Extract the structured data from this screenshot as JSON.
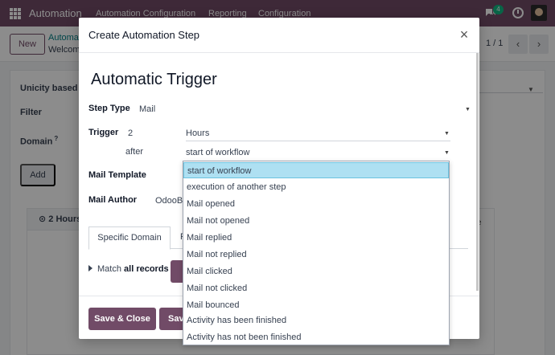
{
  "navbar": {
    "app_name": "Automation",
    "menus": [
      "Automation Configuration",
      "Reporting",
      "Configuration"
    ],
    "chat_badge": "4"
  },
  "control_panel": {
    "new_label": "New",
    "breadcrumb_parent": "Automa",
    "breadcrumb_current": "Welcom",
    "pager": "1 / 1"
  },
  "bg_form": {
    "unicity_label": "Unicity based o",
    "filter_label": "Filter",
    "domain_label": "Domain",
    "domain_help": "?",
    "add_label": "Add",
    "card_tab": "2 Hours",
    "card_e": "e"
  },
  "modal": {
    "title": "Create Automation Step",
    "heading": "Automatic Trigger",
    "step_type_label": "Step Type",
    "step_type_value": "Mail",
    "trigger_label": "Trigger",
    "trigger_interval": "2",
    "trigger_unit": "Hours",
    "trigger_after": "after",
    "trigger_type": "start of workflow",
    "mail_template_label": "Mail Template",
    "mail_author_label": "Mail Author",
    "mail_author_value": "OdooB",
    "tab_specific_domain": "Specific Domain",
    "tab_second": "F",
    "match_prefix": "Match",
    "match_bold": "all records",
    "save_close_label": "Save & Close",
    "save_label": "Save"
  },
  "dropdown": {
    "options": [
      "start of workflow",
      "execution of another step",
      "Mail opened",
      "Mail not opened",
      "Mail replied",
      "Mail not replied",
      "Mail clicked",
      "Mail not clicked",
      "Mail bounced",
      "Activity has been finished",
      "Activity has not been finished"
    ],
    "selected": "start of workflow"
  },
  "colors": {
    "brand": "#714b67",
    "selected_option": "#aee0f2",
    "badge": "#10b981"
  }
}
